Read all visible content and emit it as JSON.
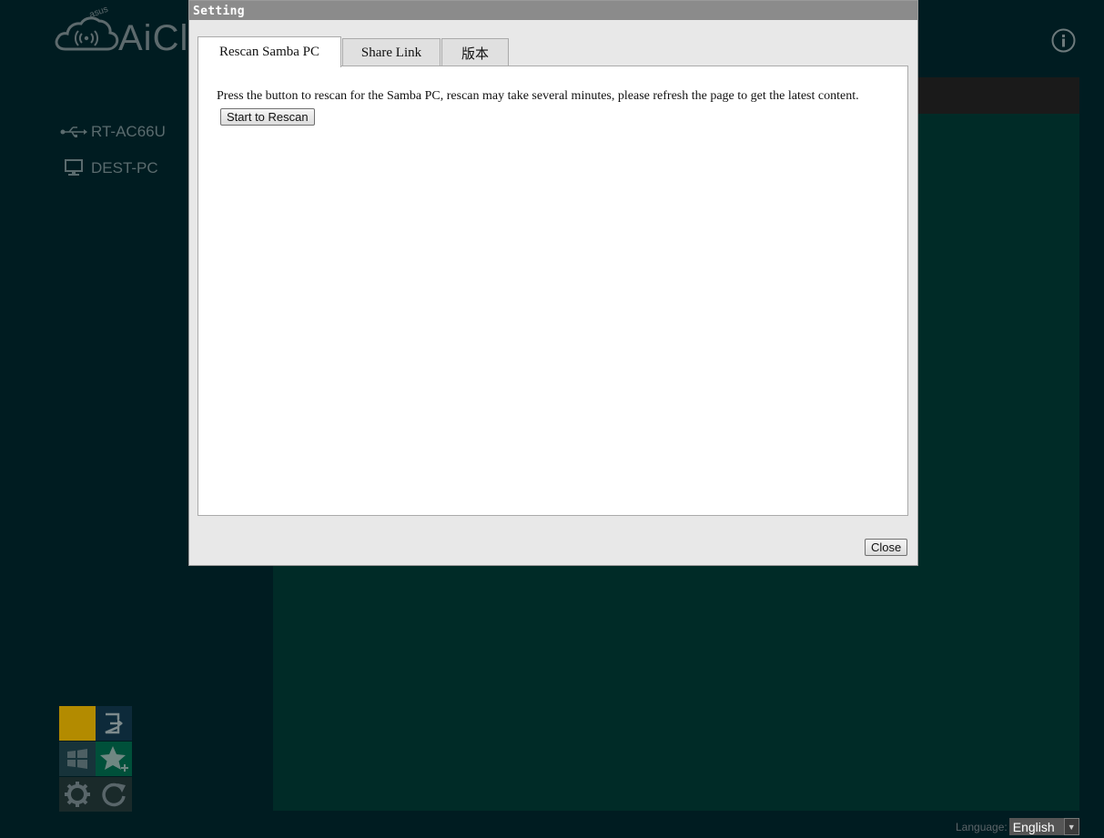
{
  "app": {
    "logo_badge": "asus",
    "logo_text": "AiCl"
  },
  "sidebar": {
    "items": [
      {
        "label": "RT-AC66U",
        "icon": "usb-icon"
      },
      {
        "label": "DEST-PC",
        "icon": "monitor-icon"
      }
    ]
  },
  "tiles": [
    {
      "icon": "blank-tile",
      "color": "#b38b00"
    },
    {
      "icon": "logout-icon",
      "color": "#0d2a3a"
    },
    {
      "icon": "windows-icon",
      "color": "#17333a"
    },
    {
      "icon": "star-plus-icon",
      "color": "#00503a"
    },
    {
      "icon": "gear-icon",
      "color": "#1a2a2a"
    },
    {
      "icon": "refresh-icon",
      "color": "#1a2a2a"
    }
  ],
  "footer": {
    "language_label": "Language:",
    "language_value": "English"
  },
  "dialog": {
    "title": "Setting",
    "tabs": [
      {
        "label": "Rescan Samba PC",
        "active": true
      },
      {
        "label": "Share Link",
        "active": false
      },
      {
        "label": "版本",
        "active": false
      }
    ],
    "message": "Press the button to rescan for the Samba PC, rescan may take several minutes, please refresh the page to get the latest content.",
    "rescan_button": "Start to Rescan",
    "close_button": "Close"
  },
  "colors": {
    "background": "#001c21",
    "content_panel": "#002b27",
    "dialog_title_bar": "#8b8b8b"
  }
}
